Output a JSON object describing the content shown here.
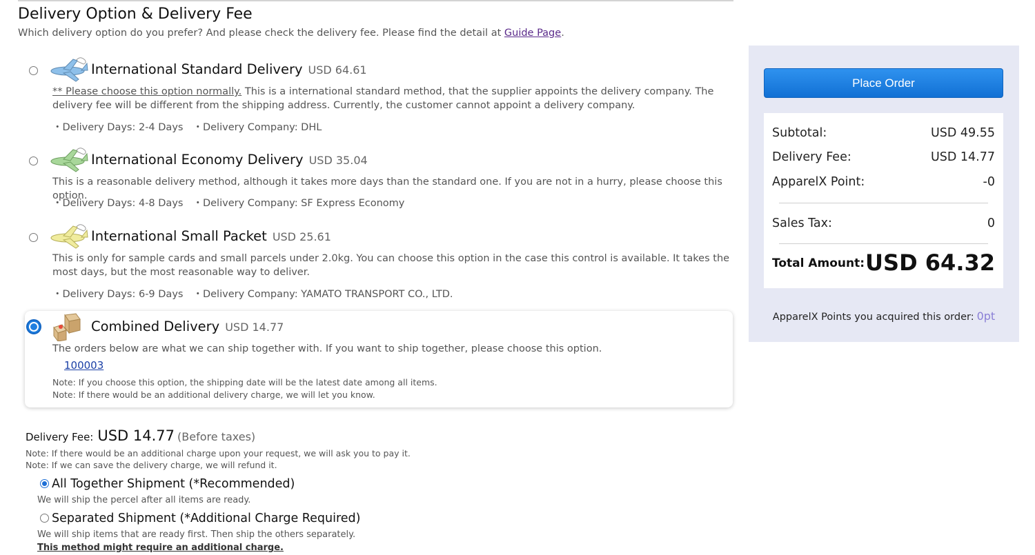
{
  "section": {
    "title": "Delivery Option & Delivery Fee",
    "subtitle_prefix": "Which delivery option do you prefer? And please check the delivery fee. Please find the detail at ",
    "guide_link": "Guide Page",
    "subtitle_suffix": "."
  },
  "options": [
    {
      "name": "International Standard Delivery",
      "price": "USD 64.61",
      "desc_underlined": "** Please choose this option normally.",
      "desc": " This is a international standard method, that the supplier appoints the delivery company. The delivery fee will be different from the shipping address. Currently, the customer cannot appoint a delivery company.",
      "days": "・Delivery Days: 2-4 Days",
      "company": "・Delivery Company: DHL",
      "icon_color": "#8ec0ea"
    },
    {
      "name": "International Economy Delivery",
      "price": "USD 35.04",
      "desc": "This is a reasonable delivery method, although it takes more days than the standard one. If you are not in a hurry, please choose this option.",
      "days": "・Delivery Days: 4-8 Days",
      "company": "・Delivery Company: SF Express Economy",
      "icon_color": "#a8d79a"
    },
    {
      "name": "International Small Packet",
      "price": "USD 25.61",
      "desc": "This is only for sample cards and small parcels under 2.0kg. You can choose this option in the case this control is available. It takes the most days, but the most reasonable way to deliver.",
      "days": "・Delivery Days: 6-9 Days",
      "company": "・Delivery Company: YAMATO TRANSPORT CO., LTD.",
      "icon_color": "#f0ec9e"
    },
    {
      "name": "Combined Delivery",
      "price": "USD 14.77",
      "desc": "The orders below are what we can ship together with. If you want to ship together, please choose this option.",
      "order_link": "100003",
      "note1": "Note: If you choose this option, the shipping date will be the latest date among all items.",
      "note2": "Note: If there would be an additional delivery charge, we will let you know.",
      "selected": true
    }
  ],
  "fee": {
    "label": "Delivery Fee:",
    "value": "USD 14.77",
    "suffix": "(Before taxes)",
    "note1": "Note: If there would be an additional charge upon your request, we will ask you to pay it.",
    "note2": "Note: If we can save the delivery charge, we will refund it."
  },
  "shipment": {
    "together_label": "All Together Shipment (*Recommended)",
    "together_desc": "We will ship the percel after all items are ready.",
    "separate_label": "Separated Shipment (*Additional Charge Required)",
    "separate_desc": "We will ship items that are ready first. Then ship the others separately.",
    "separate_warning": "This method might require an additional charge.",
    "selected": "together"
  },
  "summary": {
    "place_order": "Place Order",
    "subtotal_label": "Subtotal:",
    "subtotal_value": "USD 49.55",
    "delivery_label": "Delivery Fee:",
    "delivery_value": "USD 14.77",
    "point_label": "ApparelX Point:",
    "point_value": "-0",
    "tax_label": "Sales Tax:",
    "tax_value": "0",
    "total_label": "Total Amount:",
    "total_value": "USD 64.32",
    "points_text": "ApparelX Points you acquired this order:",
    "points_value": "0pt"
  },
  "colors": {
    "accent": "#1f7fe0",
    "panel": "#e6e8f4",
    "link": "#1a3fa6"
  }
}
